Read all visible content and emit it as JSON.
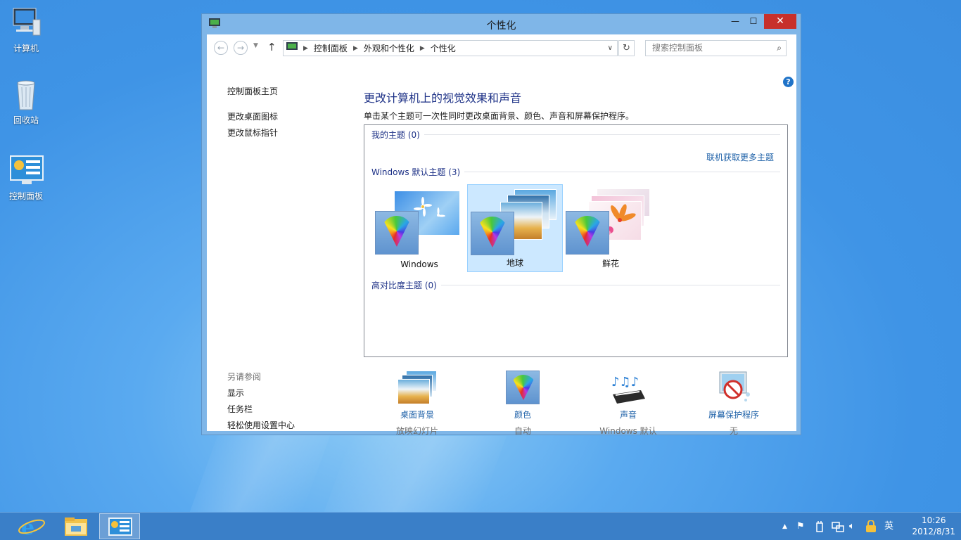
{
  "desktop": {
    "icons": [
      {
        "label": "计算机"
      },
      {
        "label": "回收站"
      },
      {
        "label": "控制面板"
      }
    ]
  },
  "window": {
    "title": "个性化",
    "buttons": {
      "minimize": "—",
      "maximize": "☐",
      "close": "✕"
    },
    "breadcrumb": [
      "控制面板",
      "外观和个性化",
      "个性化"
    ],
    "search_placeholder": "搜索控制面板"
  },
  "leftnav": {
    "home": "控制面板主页",
    "desktop_icons": "更改桌面图标",
    "mouse_pointer": "更改鼠标指针",
    "see_also": "另请参阅",
    "display": "显示",
    "taskbar": "任务栏",
    "ease_of_access": "轻松使用设置中心"
  },
  "main": {
    "heading": "更改计算机上的视觉效果和声音",
    "description": "单击某个主题可一次性同时更改桌面背景、颜色、声音和屏幕保护程序。",
    "my_themes": "我的主题 (0)",
    "get_more": "联机获取更多主题",
    "windows_themes": "Windows 默认主题 (3)",
    "themes": [
      {
        "name": "Windows",
        "selected": false
      },
      {
        "name": "地球",
        "selected": true
      },
      {
        "name": "鲜花",
        "selected": false
      }
    ],
    "high_contrast": "高对比度主题 (0)"
  },
  "settings": [
    {
      "label": "桌面背景",
      "value": "放映幻灯片",
      "icon": "desktop-background-icon"
    },
    {
      "label": "颜色",
      "value": "自动",
      "icon": "color-icon"
    },
    {
      "label": "声音",
      "value": "Windows 默认",
      "icon": "sound-icon"
    },
    {
      "label": "屏幕保护程序",
      "value": "无",
      "icon": "screensaver-icon"
    }
  ],
  "taskbar": {
    "ime": "英",
    "time": "10:26",
    "date": "2012/8/31"
  },
  "colors": {
    "accent": "#1e3287",
    "link": "#1e61a8",
    "close": "#c7302b",
    "selection": "#cce8ff"
  }
}
